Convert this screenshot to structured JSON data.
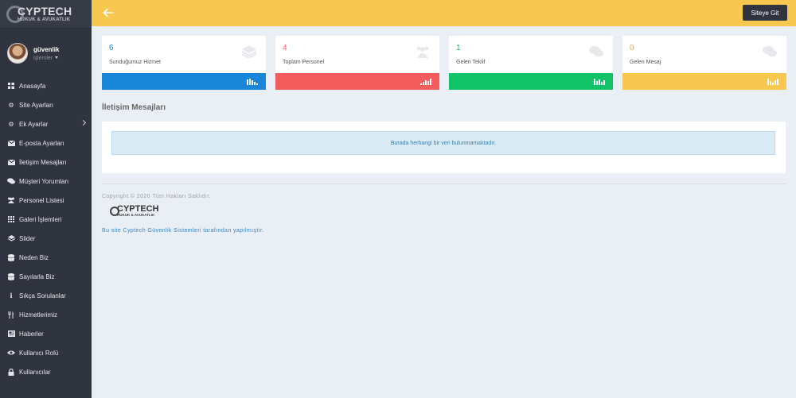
{
  "brand": {
    "name": "CYPTECH",
    "sub": "HUKUK & AVUKATLIK"
  },
  "user": {
    "name": "güvenlik",
    "role": "işlemler"
  },
  "menu": [
    {
      "label": "Anasayfa",
      "icon": "dashboard-icon"
    },
    {
      "label": "Site Ayarları",
      "icon": "gear-icon"
    },
    {
      "label": "Ek Ayarlar",
      "icon": "gears-icon"
    },
    {
      "label": "E-posta Ayarları",
      "icon": "envelope-icon"
    },
    {
      "label": "İletişim Mesajları",
      "icon": "envelope-icon"
    },
    {
      "label": "Müşteri Yorumları",
      "icon": "comments-icon"
    },
    {
      "label": "Personel Listesi",
      "icon": "users-icon"
    },
    {
      "label": "Galeri İşlemleri",
      "icon": "grid-icon"
    },
    {
      "label": "Slider",
      "icon": "layers-icon"
    },
    {
      "label": "Neden Biz",
      "icon": "database-icon"
    },
    {
      "label": "Sayılarla Biz",
      "icon": "database-icon"
    },
    {
      "label": "Sıkça Sorulanlar",
      "icon": "info-icon"
    },
    {
      "label": "Hizmetlerimiz",
      "icon": "cutlery-icon"
    },
    {
      "label": "Haberler",
      "icon": "newspaper-icon"
    },
    {
      "label": "Kullanıcı Rolü",
      "icon": "eye-icon"
    },
    {
      "label": "Kullanıcılar",
      "icon": "lock-icon"
    }
  ],
  "topbar": {
    "back_icon": "arrow-left-icon",
    "site_button": "Siteye Git",
    "color": "#f8c74f"
  },
  "stats": [
    {
      "value": "6",
      "label": "Sunduğumuz Hizmet",
      "color": "#1a86d9",
      "icon": "layers-icon"
    },
    {
      "value": "4",
      "label": "Toplam Personel",
      "color": "#f25c5c",
      "icon": "users-icon"
    },
    {
      "value": "1",
      "label": "Gelen Teklif",
      "color": "#12c269",
      "icon": "comments-icon"
    },
    {
      "value": "0",
      "label": "Gelen Mesaj",
      "color": "#f8c74f",
      "icon": "comments-icon"
    }
  ],
  "section": {
    "title": "İletişim Mesajları",
    "empty_text": "Burada herhangi bir veri bulunmamaktadır."
  },
  "footer": {
    "copyright": "Copyright © 2026 Tüm Hakları Saklıdır.",
    "credit": "Bu site Cyptech Güvenlik Sistemleri tarafından yapılmıştır."
  }
}
